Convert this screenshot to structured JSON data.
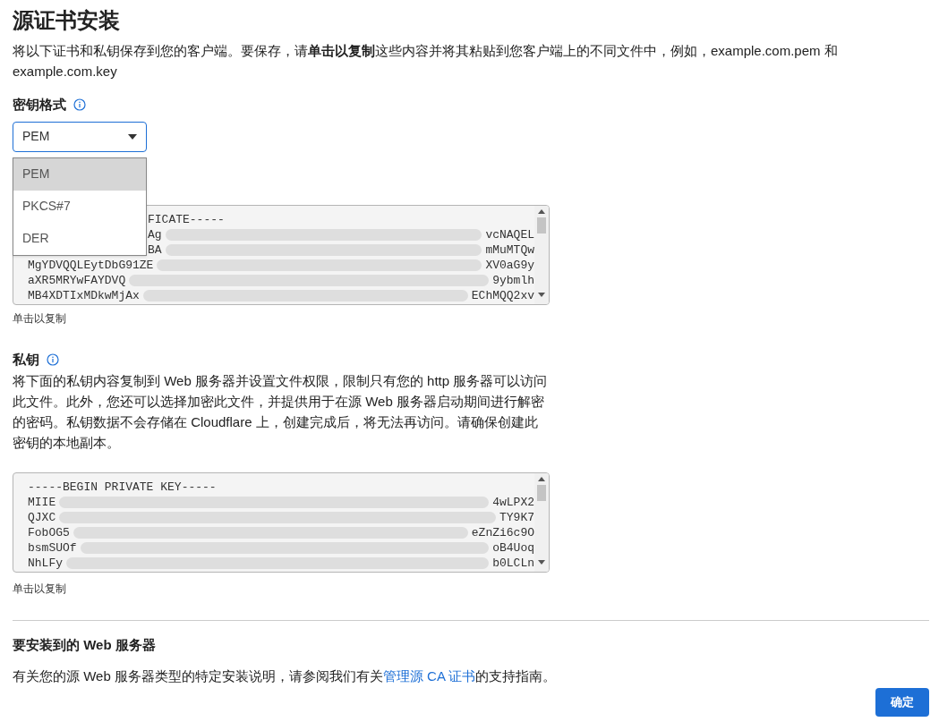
{
  "title": "源证书安装",
  "intro": "将以下证书和私钥保存到您的客户端。要保存，请**单击以复制**这些内容并将其粘贴到您客户端上的不同文件中，例如，example.com.pem 和 example.com.key",
  "key_format": {
    "label": "密钥格式",
    "value": "PEM",
    "expanded": true,
    "options": [
      {
        "label": "PEM",
        "selected": true
      },
      {
        "label": "PKCS#7",
        "selected": false
      },
      {
        "label": "DER",
        "selected": false
      }
    ]
  },
  "certificate": {
    "lines": [
      {
        "start": "FICATE-----",
        "under_menu": true
      },
      {
        "start": "Ag",
        "end": "vcNAQEL",
        "under_menu": true
      },
      {
        "start": "BA",
        "end": "mMuMTQw",
        "under_menu": true
      },
      {
        "start": "MgYDVQQLEytDbG91ZE",
        "end": "XV0aG9y",
        "under_menu": false
      },
      {
        "start": "aXR5MRYwFAYDVQ",
        "end": "9ybmlh",
        "under_menu": false
      },
      {
        "start": "MB4XDTIxMDkwMjAx",
        "end": "EChMQQ2xv",
        "under_menu": false
      }
    ],
    "copy_hint": "单击以复制"
  },
  "private_key": {
    "label": "私钥",
    "description": "将下面的私钥内容复制到 Web 服务器并设置文件权限，限制只有您的 http 服务器可以访问此文件。此外，您还可以选择加密此文件，并提供用于在源 Web 服务器启动期间进行解密的密码。私钥数据不会存储在 Cloudflare 上，创建完成后，将无法再访问。请确保创建此密钥的本地副本。",
    "lines": [
      {
        "start": "-----BEGIN PRIVATE KEY-----",
        "under_menu": false
      },
      {
        "start": "MIIE",
        "end": "4wLPX2",
        "under_menu": false
      },
      {
        "start": "QJXC",
        "end": "TY9K7",
        "under_menu": false
      },
      {
        "start": "FobOG5",
        "end": "eZnZi6c9O",
        "under_menu": false
      },
      {
        "start": "bsmSUOf",
        "end": "oB4Uoq",
        "under_menu": false
      },
      {
        "start": "NhLFy",
        "end": "b0LCLn",
        "under_menu": false
      }
    ],
    "copy_hint": "单击以复制"
  },
  "server": {
    "heading": "要安装到的 Web 服务器",
    "text_before": "有关您的源 Web 服务器类型的特定安装说明，请参阅我们有关",
    "link": "管理源 CA 证书",
    "text_after": "的支持指南。"
  },
  "confirm_button": "确定"
}
